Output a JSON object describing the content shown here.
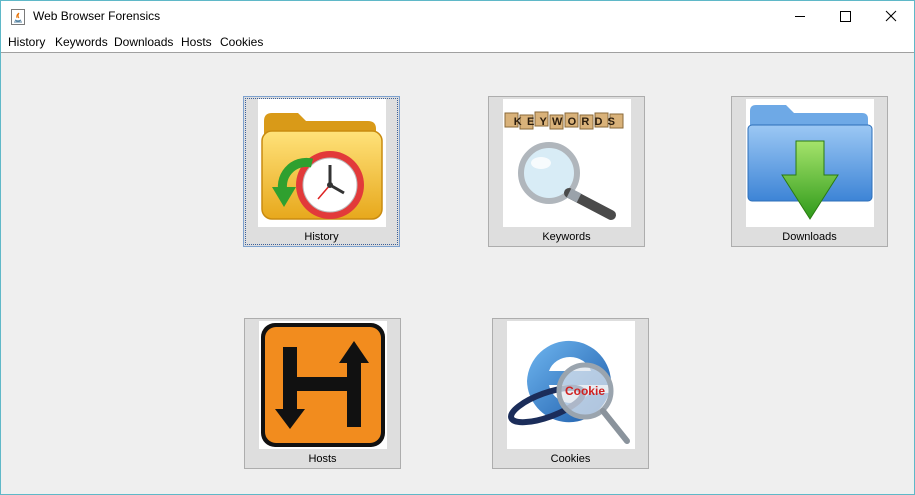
{
  "window": {
    "title": "Web Browser Forensics"
  },
  "menu": [
    "History",
    "Keywords",
    "Downloads",
    "Hosts",
    "Cookies"
  ],
  "tiles": [
    {
      "label": "History"
    },
    {
      "label": "Keywords",
      "image_text": "KEYWORDS"
    },
    {
      "label": "Downloads"
    },
    {
      "label": "Hosts"
    },
    {
      "label": "Cookies",
      "image_text": "Cookie"
    }
  ],
  "icons": {
    "app": "java-app-icon",
    "minimize": "minimize-icon",
    "maximize": "maximize-icon",
    "close": "close-icon"
  },
  "colors": {
    "window_border": "#5fb8c8",
    "content_bg": "#efefef",
    "tile_bg": "#dedede",
    "focus_border": "#3a5f9a"
  }
}
